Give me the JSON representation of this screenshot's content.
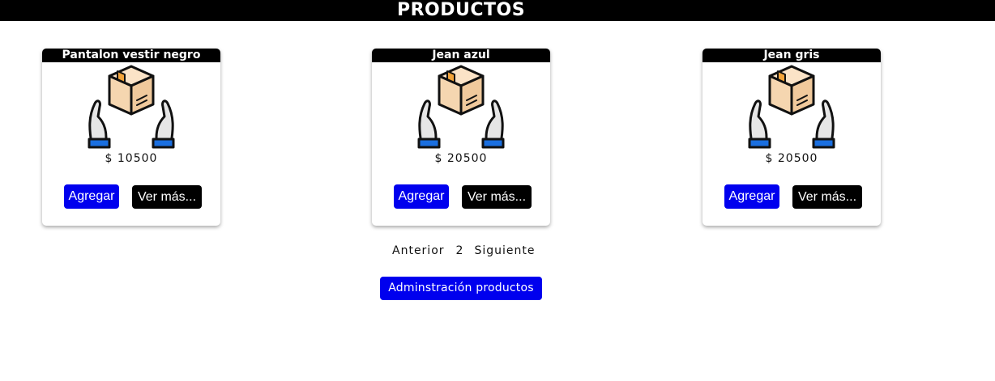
{
  "header": {
    "title": "PRODUCTOS"
  },
  "products": [
    {
      "name": "Pantalon vestir negro",
      "price": "$ 10500",
      "add_label": "Agregar",
      "more_label": "Ver más..."
    },
    {
      "name": "Jean azul",
      "price": "$ 20500",
      "add_label": "Agregar",
      "more_label": "Ver más..."
    },
    {
      "name": "Jean gris",
      "price": "$ 20500",
      "add_label": "Agregar",
      "more_label": "Ver más..."
    }
  ],
  "pagination": {
    "prev_label": "Anterior",
    "current_page": "2",
    "next_label": "Siguiente"
  },
  "admin_button": {
    "label": "Adminstración productos"
  },
  "icons": {
    "product_image": "hands-holding-box-icon"
  },
  "colors": {
    "primary_button": "#0000ee",
    "secondary_button": "#000000",
    "header_bg": "#000000",
    "box": "#f5d6b0",
    "box_tape": "#f2a33a",
    "cuff": "#1a6fe0"
  }
}
